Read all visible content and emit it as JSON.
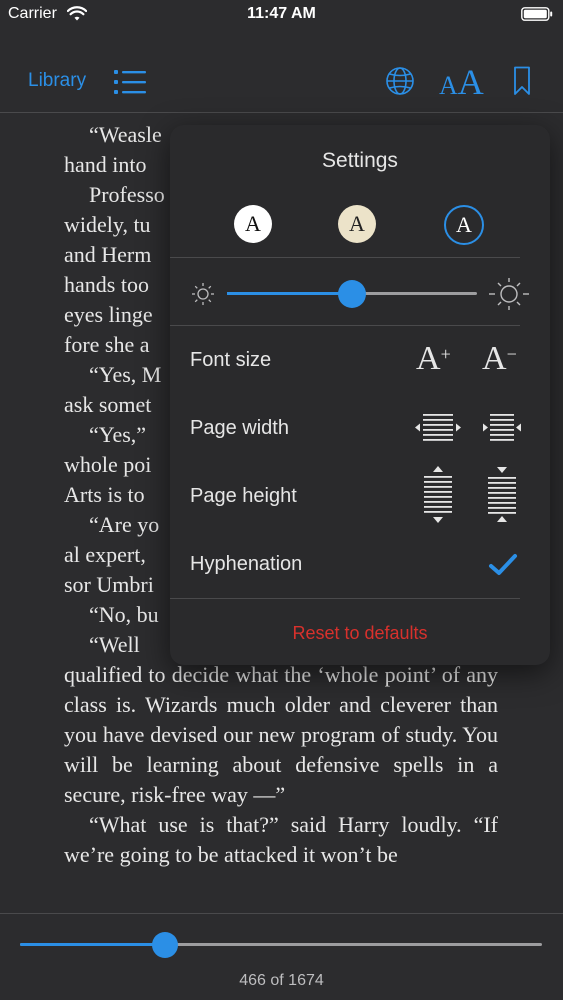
{
  "status": {
    "carrier": "Carrier",
    "time": "11:47 AM"
  },
  "nav": {
    "library_label": "Library",
    "font_small": "A",
    "font_big": "A"
  },
  "content": {
    "paragraphs": [
      "“Weasle",
      "hand into",
      "Professo",
      "widely, tu",
      "and Herm",
      "hands too",
      "eyes linge",
      "fore she a",
      "“Yes, M",
      "ask somet",
      "“Yes,”",
      "whole poi",
      "Arts is to",
      "“Are yo",
      "al expert,",
      "sor Umbri",
      "“No, bu",
      "“Well",
      "qualified to decide what the ‘whole point’ of any class is. Wizards much older and cleverer than you have devised our new program of study. You will be learning about defensive spells in a secure, risk-free way —”",
      "“What use is that?” said Harry loudly. “If we’re going to be attacked it won’t be"
    ]
  },
  "settings": {
    "title": "Settings",
    "theme_letter": "A",
    "themes": [
      "white",
      "sepia",
      "dark"
    ],
    "selected_theme": "dark",
    "brightness_fraction": 0.5,
    "font_size_label": "Font size",
    "font_increase": "A",
    "font_increase_mark": "+",
    "font_decrease": "A",
    "font_decrease_mark": "−",
    "page_width_label": "Page width",
    "page_height_label": "Page height",
    "hyphenation_label": "Hyphenation",
    "hyphenation_on": true,
    "reset_label": "Reset to defaults"
  },
  "footer": {
    "page_counter": "466 of 1674",
    "current_page": 466,
    "total_pages": 1674
  },
  "colors": {
    "accent": "#2b8fe6",
    "background": "#2c2c2e",
    "reset": "#d8312c"
  }
}
